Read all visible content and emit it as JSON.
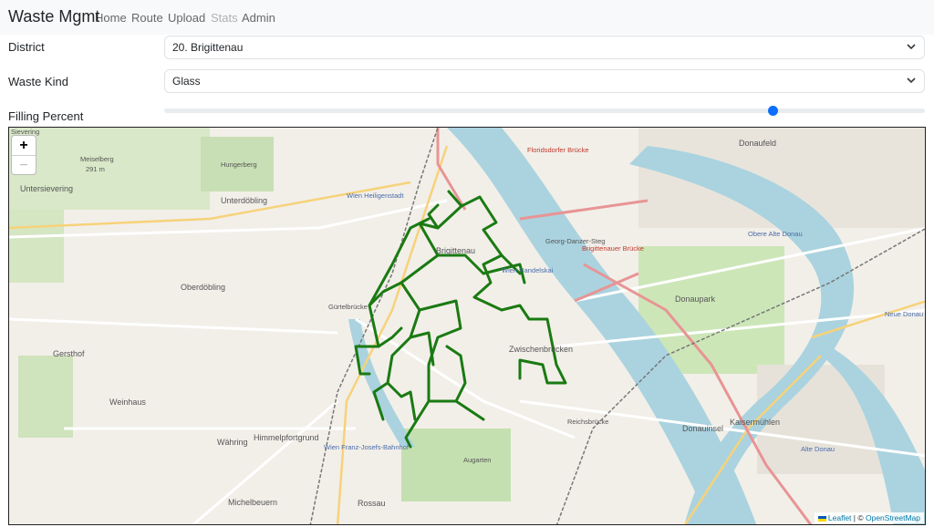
{
  "navbar": {
    "brand": "Waste Mgmt",
    "links": [
      {
        "label": "Home",
        "disabled": false
      },
      {
        "label": "Route",
        "disabled": false
      },
      {
        "label": "Upload",
        "disabled": false
      },
      {
        "label": "Stats",
        "disabled": true
      },
      {
        "label": "Admin",
        "disabled": false
      }
    ]
  },
  "form": {
    "district": {
      "label": "District",
      "value": "20. Brigittenau",
      "icon": "chevron-down-icon"
    },
    "waste_kind": {
      "label": "Waste Kind",
      "value": "Glass",
      "icon": "chevron-down-icon"
    },
    "filling_percent": {
      "label": "Filling Percent",
      "slider_level": 0.8
    }
  },
  "map": {
    "zoom_in": "+",
    "zoom_out": "−",
    "attribution": {
      "leaflet": "Leaflet",
      "separator": " | © ",
      "osm": "OpenStreetMap"
    },
    "route_color": "#1a7a12",
    "labels": [
      {
        "text": "Sievering",
        "cls": ""
      },
      {
        "text": "Meiselberg",
        "cls": ""
      },
      {
        "text": "291 m",
        "cls": ""
      },
      {
        "text": "Untersievering",
        "cls": "big"
      },
      {
        "text": "Hungerberg",
        "cls": ""
      },
      {
        "text": "Unterdöbling",
        "cls": "big"
      },
      {
        "text": "Wien Heiligenstadt",
        "cls": "blue"
      },
      {
        "text": "Floridsdorfer Brücke",
        "cls": "red"
      },
      {
        "text": "Donaufeld",
        "cls": "big"
      },
      {
        "text": "Oberdöbling",
        "cls": "big"
      },
      {
        "text": "Brigittenau",
        "cls": "big"
      },
      {
        "text": "Wien Handelskai",
        "cls": "blue"
      },
      {
        "text": "Georg-Danzer-Steg",
        "cls": ""
      },
      {
        "text": "Brigittenauer Brücke",
        "cls": "red"
      },
      {
        "text": "Donaupark",
        "cls": "big"
      },
      {
        "text": "Gersthof",
        "cls": "big"
      },
      {
        "text": "Gürtelbrücke",
        "cls": ""
      },
      {
        "text": "Zwischenbrücken",
        "cls": "big"
      },
      {
        "text": "Weinhaus",
        "cls": "big"
      },
      {
        "text": "Reichsbrücke",
        "cls": ""
      },
      {
        "text": "Kaisermühlen",
        "cls": "big"
      },
      {
        "text": "Donauinsel",
        "cls": "big"
      },
      {
        "text": "Währing",
        "cls": "big"
      },
      {
        "text": "Himmelpfortgrund",
        "cls": "big"
      },
      {
        "text": "Wien Franz-Josefs-Bahnhof",
        "cls": "blue"
      },
      {
        "text": "Augarten",
        "cls": ""
      },
      {
        "text": "Michelbeuern",
        "cls": "big"
      },
      {
        "text": "Rossau",
        "cls": "big"
      },
      {
        "text": "Alte Donau",
        "cls": "blue"
      },
      {
        "text": "Neue Donau",
        "cls": "blue"
      },
      {
        "text": "Obere Alte Donau",
        "cls": "blue"
      }
    ]
  }
}
